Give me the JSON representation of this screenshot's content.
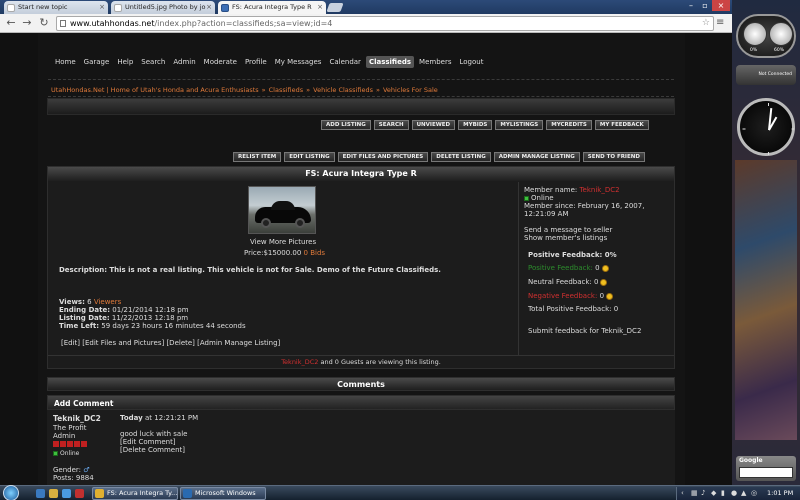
{
  "browser": {
    "tabs": [
      {
        "label": "Start new topic"
      },
      {
        "label": "Untitled5.jpg Photo by jo"
      },
      {
        "label": "FS: Acura Integra Type R"
      }
    ],
    "url_domain": "www.utahhondas.net",
    "url_rest": "/index.php?action=classifieds;sa=view;id=4"
  },
  "nav": {
    "items": [
      "Home",
      "Garage",
      "Help",
      "Search",
      "Admin",
      "Moderate",
      "Profile",
      "My Messages",
      "Calendar",
      "Classifieds",
      "Members",
      "Logout"
    ],
    "current": "Classifieds"
  },
  "breadcrumb": [
    "UtahHondas.Net | Home of Utah's Honda and Acura Enthusiasts",
    "Classifieds",
    "Vehicle Classifieds",
    "Vehicles For Sale"
  ],
  "breadcrumb_sep": "»",
  "toolbar1": [
    "ADD LISTING",
    "SEARCH",
    "UNVIEWED",
    "MYBIDS",
    "MYLISTINGS",
    "MYCREDITS",
    "MY FEEDBACK"
  ],
  "toolbar2": [
    "RELIST ITEM",
    "EDIT LISTING",
    "EDIT FILES AND PICTURES",
    "DELETE LISTING",
    "ADMIN MANAGE LISTING",
    "SEND TO FRIEND"
  ],
  "listing": {
    "title": "FS: Acura Integra Type R",
    "view_more": "View More Pictures",
    "price_label": "Price:",
    "price": "$15000.00",
    "bids": "0 Bids",
    "description_label": "Description:",
    "description": "This is not a real listing.  This vehicle is not for Sale.  Demo of the Future Classifieds.",
    "views_label": "Views:",
    "views_count": "6",
    "viewers": "Viewers",
    "ending_label": "Ending Date:",
    "ending": "01/21/2014 12:18 pm",
    "listing_label": "Listing Date:",
    "listing_date": "11/22/2013 12:18 pm",
    "timeleft_label": "Time Left:",
    "timeleft": "59 days 23 hours 16 minutes 44 seconds",
    "actions": [
      "[Edit]",
      "[Edit Files and Pictures]",
      "[Delete]",
      "[Admin Manage Listing]"
    ],
    "viewing_user": "Teknik_DC2",
    "viewing_rest": "and 0 Guests are viewing this listing."
  },
  "member": {
    "name_label": "Member name:",
    "name": "Teknik_DC2",
    "status": "Online",
    "since_label": "Member since:",
    "since_date": "February 16, 2007,",
    "since_time": "12:21:09 AM",
    "send_message": "Send a message to seller",
    "show_listings": "Show member's listings",
    "positive_pct_label": "Positive Feedback: 0%",
    "positive_label": "Positive Feedback:",
    "positive": "0",
    "neutral_label": "Neutral Feedback:",
    "neutral": "0",
    "negative_label": "Negative Feedback:",
    "negative": "0",
    "total_label": "Total Positive Feedback:",
    "total": "0",
    "submit_feedback": "Submit feedback for Teknik_DC2"
  },
  "comments": {
    "header": "Comments",
    "add": "Add Comment",
    "author": "Teknik_DC2",
    "title": "The Profit",
    "role": "Admin",
    "status": "Online",
    "gender_label": "Gender:",
    "posts_label": "Posts:",
    "posts": "9884",
    "date": "Today",
    "time": "at 12:21:21 PM",
    "body": "good luck with sale",
    "edit": "[Edit Comment]",
    "delete": "[Delete Comment]"
  },
  "sidebar": {
    "cpu_pct": "0%",
    "ram_pct": "60%",
    "network": "Not Connected",
    "google_label": "Google"
  },
  "taskbar": {
    "buttons": [
      "FS: Acura Integra Ty...",
      "Microsoft Windows"
    ],
    "time": "1:01 PM"
  },
  "colors": {
    "accent": "#e07a3a",
    "negative": "#d03030",
    "positive": "#2c8c2c"
  }
}
